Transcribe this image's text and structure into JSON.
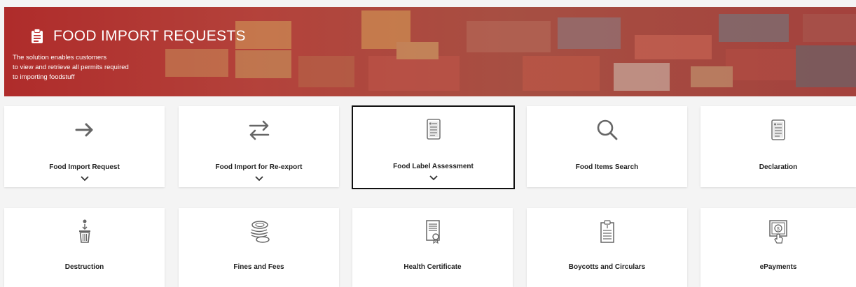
{
  "banner": {
    "title": "FOOD IMPORT REQUESTS",
    "description_lines": [
      "The solution enables customers",
      "to view and retrieve all permits required",
      "to importing foodstuff"
    ]
  },
  "services": [
    {
      "label": "Food Import Request",
      "icon": "arrow-right-icon",
      "expandable": true
    },
    {
      "label": "Food Import for Re-export",
      "icon": "swap-arrows-icon",
      "expandable": true
    },
    {
      "label": "Food Label Assessment",
      "icon": "clipboard-list-icon",
      "expandable": true,
      "selected": true
    },
    {
      "label": "Food Items Search",
      "icon": "search-icon",
      "expandable": false
    },
    {
      "label": "Declaration",
      "icon": "clipboard-list-icon",
      "expandable": false
    },
    {
      "label": "Destruction",
      "icon": "trash-icon",
      "expandable": false
    },
    {
      "label": "Fines and Fees",
      "icon": "coins-icon",
      "expandable": false
    },
    {
      "label": "Health Certificate",
      "icon": "certificate-icon",
      "expandable": false
    },
    {
      "label": "Boycotts and Circulars",
      "icon": "clipboard-icon",
      "expandable": false
    },
    {
      "label": "ePayments",
      "icon": "epayment-icon",
      "expandable": false
    }
  ],
  "colors": {
    "banner_overlay": "#b22828",
    "icon_gray": "#8a8a8a",
    "card_bg": "#ffffff",
    "page_bg": "#f4f4f4"
  }
}
